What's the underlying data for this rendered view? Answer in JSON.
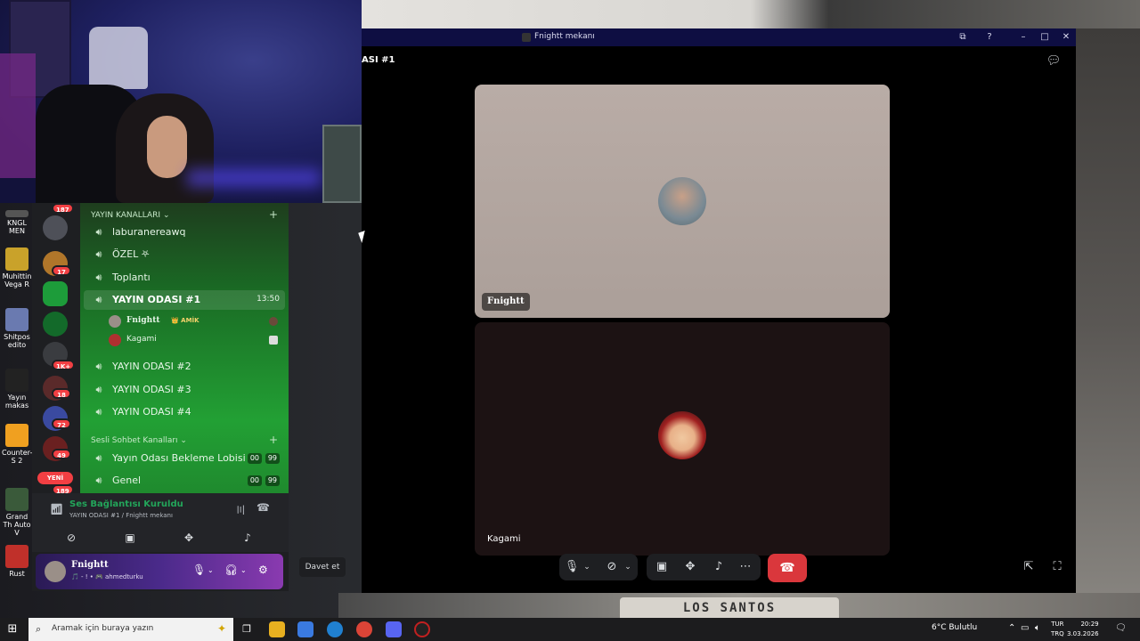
{
  "desktop": {
    "icons": [
      {
        "label": "KNGL\nMEN"
      },
      {
        "label": "Muhittin Vega R"
      },
      {
        "label": "Shitpos edito"
      },
      {
        "label": "Yayın makas"
      },
      {
        "label": "Counter-S 2"
      },
      {
        "label": "Grand Th Auto V"
      },
      {
        "label": "Rust"
      }
    ],
    "room_sign": "LOS SANTOS"
  },
  "discord": {
    "servers": {
      "badges": [
        "187",
        "17",
        "1K+",
        "18",
        "72",
        "49",
        "189"
      ],
      "new_label": "YENİ"
    },
    "categories": [
      {
        "label": "YAYIN KANALLARI ⌄"
      },
      {
        "label": "Sesli Sohbet Kanalları ⌄"
      }
    ],
    "channels": [
      {
        "label": "laburanereawq"
      },
      {
        "label": "ÖZEL ⛧"
      },
      {
        "label": "Toplantı"
      },
      {
        "label": "YAYIN ODASI #1",
        "time": "13:50"
      },
      {
        "label": "YAYIN ODASI #2"
      },
      {
        "label": "YAYIN ODASI #3"
      },
      {
        "label": "YAYIN ODASI #4"
      },
      {
        "label": "Yayın Odası Bekleme Lobisi",
        "count_a": "00",
        "count_b": "99"
      },
      {
        "label": "Genel",
        "count_a": "00",
        "count_b": "99"
      }
    ],
    "members": [
      {
        "name": "Fnightt",
        "tag": "👑 AMİK"
      },
      {
        "name": "Kagami"
      }
    ],
    "voice_status": {
      "title": "Ses Bağlantısı Kuruldu",
      "subtitle": "YAYIN ODASI #1 / Fnightt mekanı"
    },
    "user": {
      "name": "Fnightt",
      "status": "🎵 - ! • 🎮 ahmedturku"
    }
  },
  "call_window": {
    "title": "Fnightt mekanı",
    "room_name": "ASI #1",
    "participants": [
      {
        "name": "Fnightt"
      },
      {
        "name": "Kagami"
      }
    ],
    "invite_label": "Davet et"
  },
  "taskbar": {
    "search_placeholder": "Aramak için buraya yazın",
    "weather": "6°C  Bulutlu",
    "lang_top": "TUR",
    "lang_bottom": "TRQ",
    "time": "20:29",
    "date": "3.03.2026"
  },
  "colors": {
    "discord_green": "#23a55a",
    "end_call_red": "#da373c",
    "titlebar": "#0e0e42"
  }
}
